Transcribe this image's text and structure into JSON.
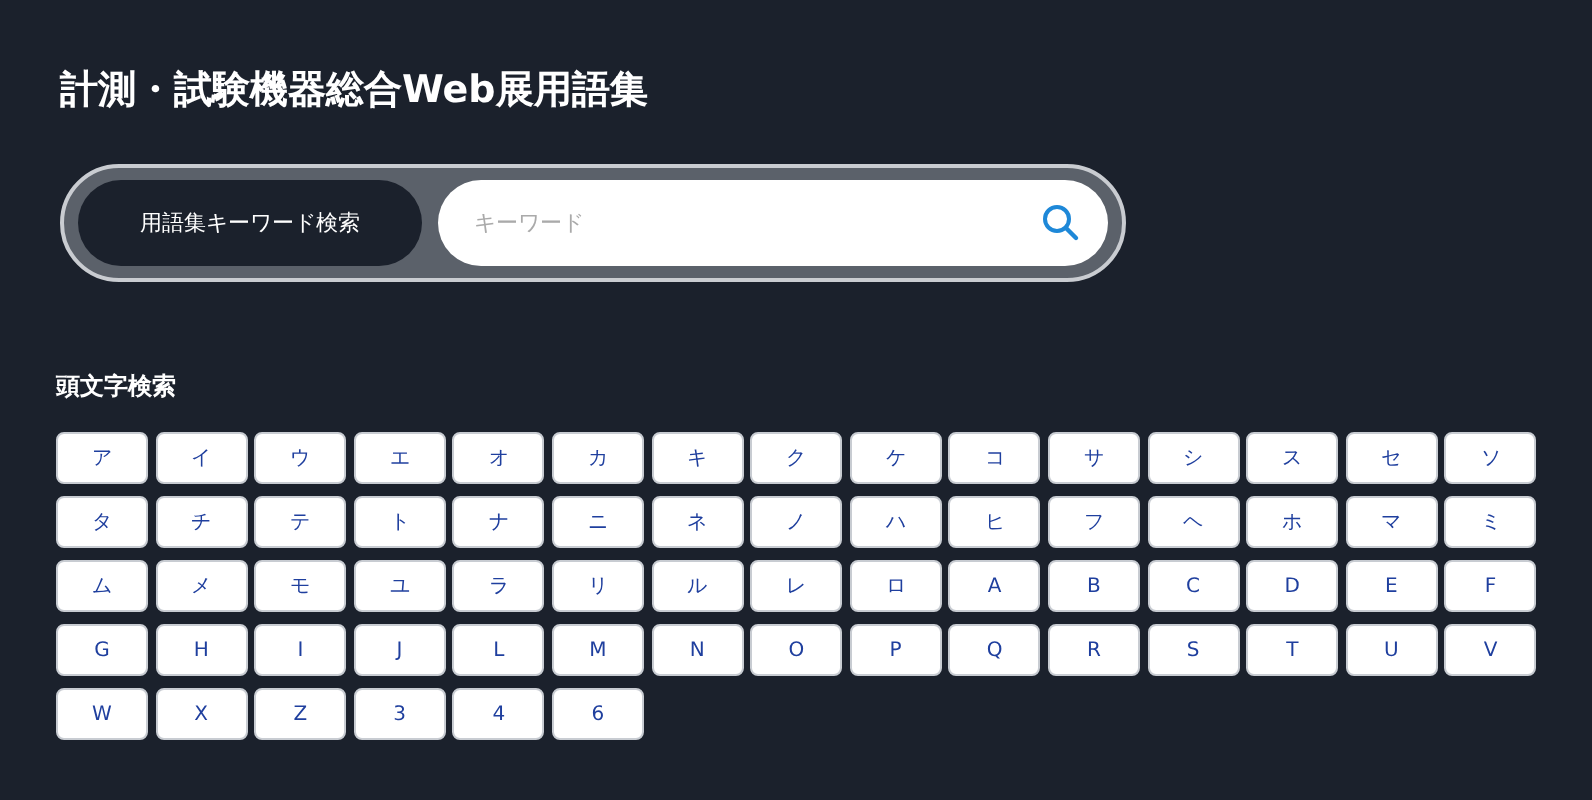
{
  "title": "計測・試験機器総合Web展用語集",
  "search": {
    "label": "用語集キーワード検索",
    "placeholder": "キーワード"
  },
  "initials": {
    "heading": "頭文字検索",
    "keys": [
      "ア",
      "イ",
      "ウ",
      "エ",
      "オ",
      "カ",
      "キ",
      "ク",
      "ケ",
      "コ",
      "サ",
      "シ",
      "ス",
      "セ",
      "ソ",
      "タ",
      "チ",
      "テ",
      "ト",
      "ナ",
      "ニ",
      "ネ",
      "ノ",
      "ハ",
      "ヒ",
      "フ",
      "ヘ",
      "ホ",
      "マ",
      "ミ",
      "ム",
      "メ",
      "モ",
      "ユ",
      "ラ",
      "リ",
      "ル",
      "レ",
      "ロ",
      "A",
      "B",
      "C",
      "D",
      "E",
      "F",
      "G",
      "H",
      "I",
      "J",
      "L",
      "M",
      "N",
      "O",
      "P",
      "Q",
      "R",
      "S",
      "T",
      "U",
      "V",
      "W",
      "X",
      "Z",
      "3",
      "4",
      "6"
    ]
  }
}
